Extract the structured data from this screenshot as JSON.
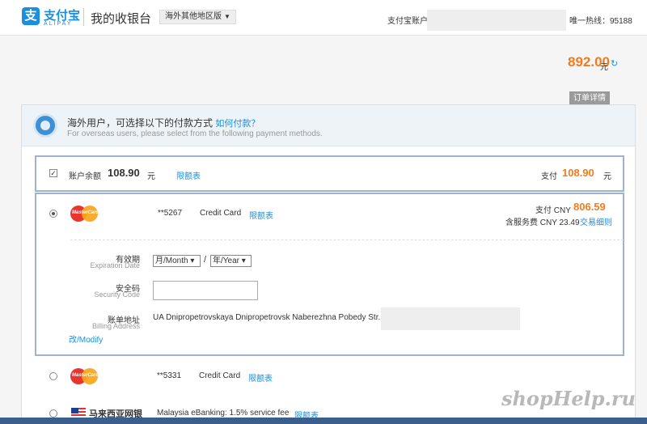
{
  "header": {
    "logo_mark": "支",
    "logo_cn": "支付宝",
    "logo_en": "ALIPAY",
    "cashier_title": "我的收银台",
    "region": "海外其他地区版",
    "account_label": "支付宝账户",
    "hotline": "唯一热线：95188"
  },
  "order": {
    "amount": "892.00",
    "unit": "元",
    "detail_tab": "订单详情"
  },
  "info": {
    "title": "海外用户，可选择以下的付款方式",
    "how_to_pay": "如何付款？",
    "subtitle": "For overseas users, please select from the following payment methods."
  },
  "balance": {
    "label": "账户余额",
    "amount": "108.90",
    "unit": "元",
    "limit_link": "限额表",
    "pay_label": "支付",
    "pay_amount": "108.90",
    "pay_unit": "元"
  },
  "card1": {
    "number": "**5267",
    "type": "Credit Card",
    "limit_link": "限额表",
    "pay_label": "支付 CNY",
    "pay_amount": "806.59",
    "fee_text": "含服务费 CNY 23.49",
    "fee_link": "交易细则",
    "expiry_cn": "有效期",
    "expiry_en": "Expiration Date",
    "month_select": "月/Month",
    "slash": "/",
    "year_select": "年/Year",
    "security_cn": "安全码",
    "security_en": "Security Code",
    "billing_cn": "账单地址",
    "billing_en": "Billing Address",
    "billing_value": "UA Dnipropetrovskaya Dnipropetrovsk Naberezhna Pobedy Str. 50",
    "modify_link": "改/Modify"
  },
  "card2": {
    "number": "**5331",
    "type": "Credit Card",
    "limit_link": "限额表"
  },
  "bank": {
    "name": "马来西亚网银",
    "fee": "Malaysia eBanking: 1.5% service fee",
    "limit_link": "限额表"
  },
  "mastercard_label": "MasterCard",
  "watermark": "shopHelp.ru",
  "colors": {
    "accent": "#1a8fe0",
    "amount": "#f37b1d",
    "box_border": "#9fb3cc"
  }
}
